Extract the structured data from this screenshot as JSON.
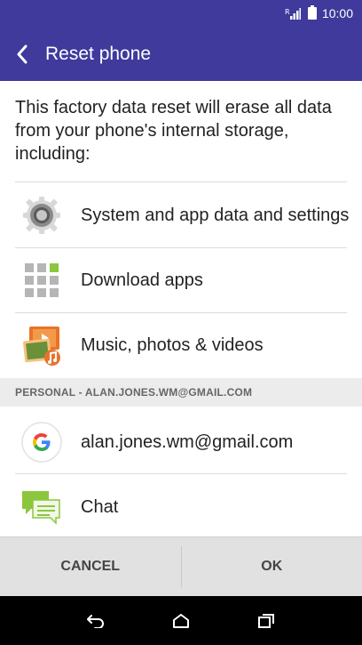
{
  "status_bar": {
    "time": "10:00"
  },
  "header": {
    "title": "Reset phone"
  },
  "intro_text": "This factory data reset will erase all data from your phone's internal storage, including:",
  "items": [
    {
      "label": "System and app data and settings",
      "icon": "gear-icon"
    },
    {
      "label": "Download apps",
      "icon": "app-grid-icon"
    },
    {
      "label": "Music, photos & videos",
      "icon": "media-icon"
    }
  ],
  "section": {
    "header": "PERSONAL - ALAN.JONES.WM@GMAIL.COM"
  },
  "accounts": [
    {
      "label": "alan.jones.wm@gmail.com",
      "icon": "google-icon"
    },
    {
      "label": "Chat",
      "icon": "chat-icon"
    }
  ],
  "buttons": {
    "cancel": "CANCEL",
    "ok": "OK"
  },
  "colors": {
    "app_bar": "#3f3a9c",
    "grid_accent": "#8cc63f"
  },
  "nav_icons": [
    "back-icon",
    "home-icon",
    "recents-icon"
  ]
}
